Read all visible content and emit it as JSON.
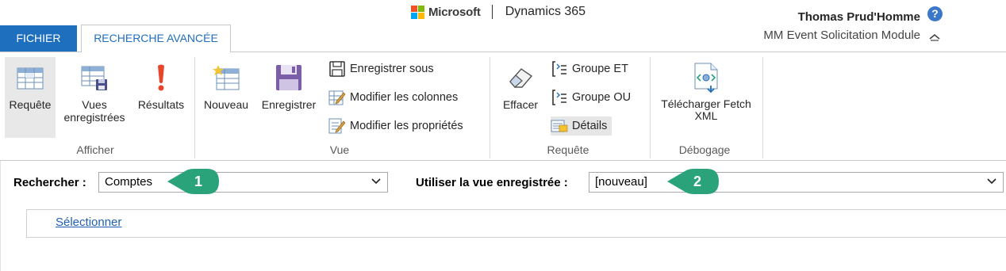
{
  "header": {
    "brand_company": "Microsoft",
    "brand_product": "Dynamics 365",
    "user_name": "Thomas Prud'Homme",
    "module_name": "MM Event Solicitation Module",
    "help_icon": "?"
  },
  "tabs": [
    {
      "label": "FICHIER"
    },
    {
      "label": "RECHERCHE AVANCÉE"
    }
  ],
  "ribbon": {
    "groups": {
      "afficher": {
        "label": "Afficher",
        "requete": "Requête",
        "vues": "Vues enregistrées",
        "resultats": "Résultats"
      },
      "vue": {
        "label": "Vue",
        "nouveau": "Nouveau",
        "enregistrer": "Enregistrer",
        "enregistrer_sous": "Enregistrer sous",
        "modifier_colonnes": "Modifier les colonnes",
        "modifier_proprietes": "Modifier les propriétés"
      },
      "requete": {
        "label": "Requête",
        "effacer": "Effacer",
        "groupe_et": "Groupe ET",
        "groupe_ou": "Groupe OU",
        "details": "Détails"
      },
      "debogage": {
        "label": "Débogage",
        "telecharger": "Télécharger Fetch XML"
      }
    }
  },
  "search": {
    "rechercher_label": "Rechercher :",
    "rechercher_value": "Comptes",
    "vue_label": "Utiliser la vue enregistrée :",
    "vue_value": "[nouveau]",
    "callout_1": "1",
    "callout_2": "2",
    "select_link": "Sélectionner"
  },
  "colors": {
    "accent_blue": "#1f6fbf",
    "callout_green": "#2aa37a",
    "ms_red": "#f25022",
    "ms_green": "#7fba00",
    "ms_blue": "#00a4ef",
    "ms_yellow": "#ffb900"
  }
}
